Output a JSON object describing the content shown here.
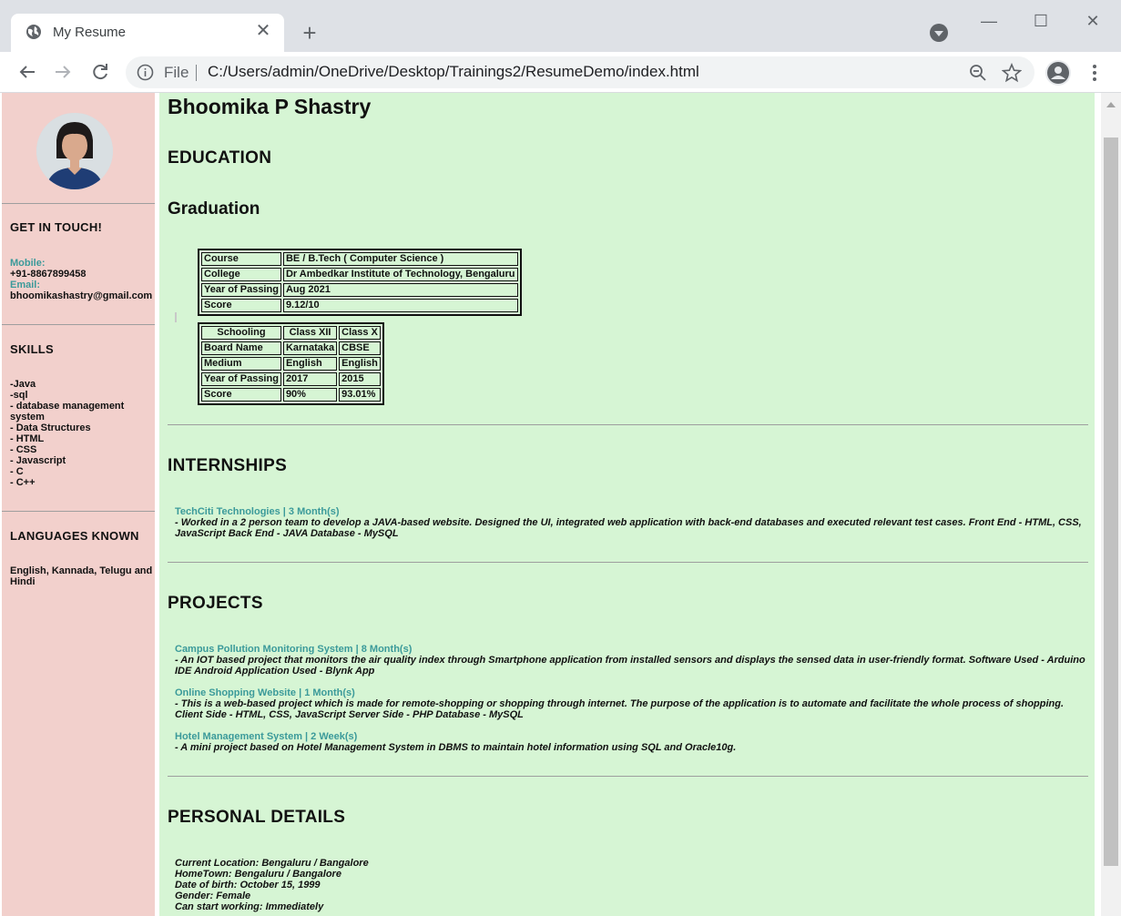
{
  "browser": {
    "tab_title": "My Resume",
    "url_scheme_label": "File",
    "url": "C:/Users/admin/OneDrive/Desktop/Trainings2/ResumeDemo/index.html"
  },
  "sidebar": {
    "contact_heading": "GET IN TOUCH!",
    "mobile_label": "Mobile:",
    "mobile_value": "+91-8867899458",
    "email_label": "Email:",
    "email_value": "bhoomikashastry@gmail.com",
    "skills_heading": "SKILLS",
    "skills": [
      "-Java",
      "-sql",
      "- database management system",
      "- Data Structures",
      "- HTML",
      "- CSS",
      "- Javascript",
      "- C",
      "- C++"
    ],
    "languages_heading": "LANGUAGES KNOWN",
    "languages_text": "English, Kannada, Telugu and Hindi"
  },
  "main": {
    "name": "Bhoomika P Shastry",
    "education_heading": "EDUCATION",
    "graduation_heading": "Graduation",
    "graduation_table": [
      [
        "Course",
        "BE / B.Tech ( Computer Science )"
      ],
      [
        "College",
        "Dr Ambedkar Institute of Technology, Bengaluru"
      ],
      [
        "Year of Passing",
        "Aug 2021"
      ],
      [
        "Score",
        "9.12/10"
      ]
    ],
    "schooling_table": {
      "headers": [
        "Schooling",
        "Class XII",
        "Class X"
      ],
      "rows": [
        [
          "Board Name",
          "Karnataka",
          "CBSE"
        ],
        [
          "Medium",
          "English",
          "English"
        ],
        [
          "Year of Passing",
          "2017",
          "2015"
        ],
        [
          "Score",
          "90%",
          "93.01%"
        ]
      ]
    },
    "internships_heading": "INTERNSHIPS",
    "internships": [
      {
        "title": "TechCiti Technologies | 3 Month(s)",
        "desc": "- Worked in a 2 person team to develop a JAVA-based website. Designed the UI, integrated web application with back-end databases and executed relevant test cases. Front End - HTML, CSS, JavaScript Back End - JAVA Database - MySQL"
      }
    ],
    "projects_heading": "PROJECTS",
    "projects": [
      {
        "title": "Campus Pollution Monitoring System | 8 Month(s)",
        "desc": "- An IOT based project that monitors the air quality index through Smartphone application from installed sensors and displays the sensed data in user-friendly format. Software Used - Arduino IDE Android Application Used - Blynk App"
      },
      {
        "title": "Online Shopping Website | 1 Month(s)",
        "desc": "- This is a web-based project which is made for remote-shopping or shopping through internet. The purpose of the application is to automate and facilitate the whole process of shopping. Client Side - HTML, CSS, JavaScript Server Side - PHP Database - MySQL"
      },
      {
        "title": "Hotel Management System | 2 Week(s)",
        "desc": "- A mini project based on Hotel Management System in DBMS to maintain hotel information using SQL and Oracle10g."
      }
    ],
    "personal_heading": "PERSONAL DETAILS",
    "personal_details": [
      "Current Location: Bengaluru / Bangalore",
      "HomeTown: Bengaluru / Bangalore",
      "Date of birth: October 15, 1999",
      "Gender: Female",
      "Can start working: Immediately"
    ]
  },
  "colors": {
    "sidebar_bg": "#f2d0cc",
    "main_bg": "#d6f5d4",
    "accent_teal": "#3b9a9a"
  },
  "icons": [
    "globe-icon",
    "close-icon",
    "plus-icon",
    "profile-dropdown-icon",
    "minimize-icon",
    "maximize-icon",
    "window-close-icon",
    "back-arrow-icon",
    "forward-arrow-icon",
    "reload-icon",
    "info-icon",
    "zoom-out-icon",
    "star-icon",
    "account-icon",
    "kebab-menu-icon"
  ]
}
